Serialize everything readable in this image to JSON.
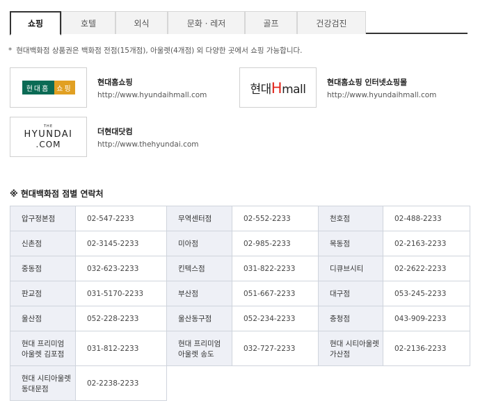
{
  "tabs": [
    {
      "label": "쇼핑",
      "active": true
    },
    {
      "label": "호텔",
      "active": false
    },
    {
      "label": "외식",
      "active": false
    },
    {
      "label": "문화 · 레저",
      "active": false
    },
    {
      "label": "골프",
      "active": false
    },
    {
      "label": "건강검진",
      "active": false
    }
  ],
  "notice": {
    "bullet": "*",
    "text": "현대백화점 상품권은 백화점 전점(15개점), 아울렛(4개점) 외 다양한 곳에서 쇼핑 가능합니다."
  },
  "sites": [
    {
      "name": "현대홈쇼핑",
      "url": "http://www.hyundaihmall.com",
      "logo": {
        "left": "현대홈",
        "right": "쇼핑"
      }
    },
    {
      "name": "현대홈쇼핑 인터넷쇼핑몰",
      "url": "http://www.hyundaihmall.com",
      "logo": {
        "pre": "현대",
        "h": "H",
        "post": "mall"
      }
    },
    {
      "name": "더현대닷컴",
      "url": "http://www.thehyundai.com",
      "logo": {
        "the": "THE",
        "main": "HYUNDAI",
        "com": ".COM"
      }
    }
  ],
  "contacts": {
    "title": "※ 현대백화점 점별 연락처",
    "rows": [
      [
        {
          "name": [
            "압구정본점"
          ],
          "phone": "02-547-2233"
        },
        {
          "name": [
            "무역센터점"
          ],
          "phone": "02-552-2233"
        },
        {
          "name": [
            "천호점"
          ],
          "phone": "02-488-2233"
        }
      ],
      [
        {
          "name": [
            "신촌점"
          ],
          "phone": "02-3145-2233"
        },
        {
          "name": [
            "미아점"
          ],
          "phone": "02-985-2233"
        },
        {
          "name": [
            "목동점"
          ],
          "phone": "02-2163-2233"
        }
      ],
      [
        {
          "name": [
            "중동점"
          ],
          "phone": "032-623-2233"
        },
        {
          "name": [
            "킨텍스점"
          ],
          "phone": "031-822-2233"
        },
        {
          "name": [
            "디큐브시티"
          ],
          "phone": "02-2622-2233"
        }
      ],
      [
        {
          "name": [
            "판교점"
          ],
          "phone": "031-5170-2233"
        },
        {
          "name": [
            "부산점"
          ],
          "phone": "051-667-2233"
        },
        {
          "name": [
            "대구점"
          ],
          "phone": "053-245-2233"
        }
      ],
      [
        {
          "name": [
            "울산점"
          ],
          "phone": "052-228-2233"
        },
        {
          "name": [
            "울산동구점"
          ],
          "phone": "052-234-2233"
        },
        {
          "name": [
            "충청점"
          ],
          "phone": "043-909-2233"
        }
      ],
      [
        {
          "name": [
            "현대 프리미엄",
            "아울렛 김포점"
          ],
          "phone": "031-812-2233"
        },
        {
          "name": [
            "현대 프리미엄",
            "아울렛 송도"
          ],
          "phone": "032-727-2233"
        },
        {
          "name": [
            "현대 시티아울렛",
            "가산점"
          ],
          "phone": "02-2136-2233"
        }
      ],
      [
        {
          "name": [
            "현대 시티아울렛",
            "동대문점"
          ],
          "phone": "02-2238-2233"
        }
      ]
    ]
  }
}
